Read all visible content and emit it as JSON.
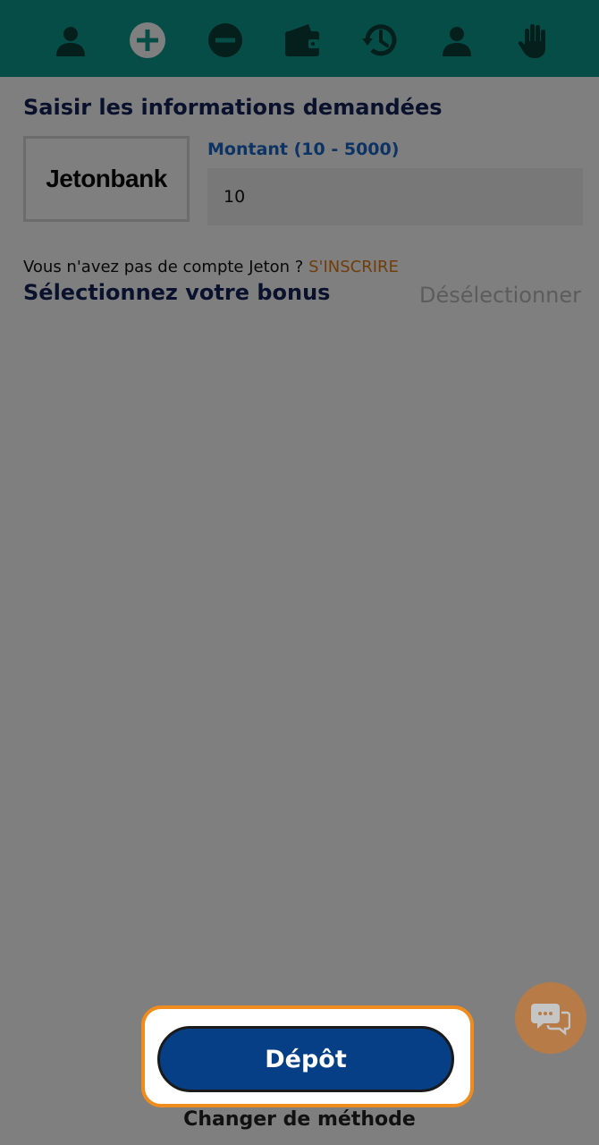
{
  "colors": {
    "header_bg": "#0f9b8e",
    "title_text": "#14225a",
    "amount_label": "#1866c7",
    "signup_link": "#e07a17",
    "deposit_button": "#063f86",
    "highlight_border": "#f08c1e",
    "chat_fab": "#e4781b"
  },
  "nav": {
    "tabs": [
      {
        "icon": "user-icon",
        "active": false
      },
      {
        "icon": "plus-circle-icon",
        "active": true
      },
      {
        "icon": "minus-circle-icon",
        "active": false
      },
      {
        "icon": "wallet-icon",
        "active": false
      },
      {
        "icon": "history-icon",
        "active": false
      },
      {
        "icon": "user-icon",
        "active": false
      },
      {
        "icon": "hand-icon",
        "active": false
      }
    ]
  },
  "form": {
    "title": "Saisir les informations demandées",
    "provider_logo": "Jetonbank",
    "amount_label": "Montant (10 - 5000)",
    "amount_value": "10",
    "account_prompt": "Vous n'avez pas de compte Jeton ? ",
    "signup_link": "S'INSCRIRE"
  },
  "bonus": {
    "title": "Sélectionnez votre bonus",
    "deselect_label": "Désélectionner"
  },
  "actions": {
    "deposit_label": "Dépôt",
    "change_method_label": "Changer de méthode"
  },
  "chat": {
    "icon": "chat-bubbles-icon"
  }
}
